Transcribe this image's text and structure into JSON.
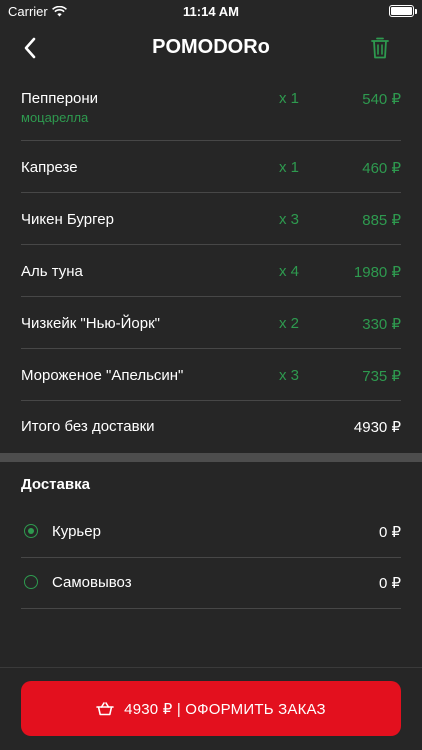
{
  "status_bar": {
    "carrier": "Carrier",
    "time": "11:14 AM"
  },
  "nav": {
    "title": "POMODORo",
    "back_icon": "chevron-left-icon",
    "trash_icon": "trash-icon"
  },
  "order": {
    "items": [
      {
        "name": "Пепперони",
        "sub": "моцарелла",
        "qty": "x 1",
        "price": "540 ₽"
      },
      {
        "name": "Капрезе",
        "qty": "x 1",
        "price": "460 ₽"
      },
      {
        "name": "Чикен Бургер",
        "qty": "x 3",
        "price": "885 ₽"
      },
      {
        "name": "Аль туна",
        "qty": "x 4",
        "price": "1980 ₽"
      },
      {
        "name": "Чизкейк \"Нью-Йорк\"",
        "qty": "x 2",
        "price": "330 ₽"
      },
      {
        "name": "Мороженое \"Апельсин\"",
        "qty": "x 3",
        "price": "735 ₽"
      }
    ],
    "total_label": "Итого без доставки",
    "total_value": "4930 ₽"
  },
  "delivery": {
    "title": "Доставка",
    "options": [
      {
        "label": "Курьер",
        "price": "0 ₽",
        "selected": true
      },
      {
        "label": "Самовывоз",
        "price": "0 ₽",
        "selected": false
      }
    ]
  },
  "checkout": {
    "label": "4930 ₽ | ОФОРМИТЬ ЗАКАЗ",
    "icon": "basket-icon"
  },
  "colors": {
    "background": "#262626",
    "accent_green": "#2e9a4f",
    "button_red": "#e3101e",
    "divider": "#474747"
  }
}
